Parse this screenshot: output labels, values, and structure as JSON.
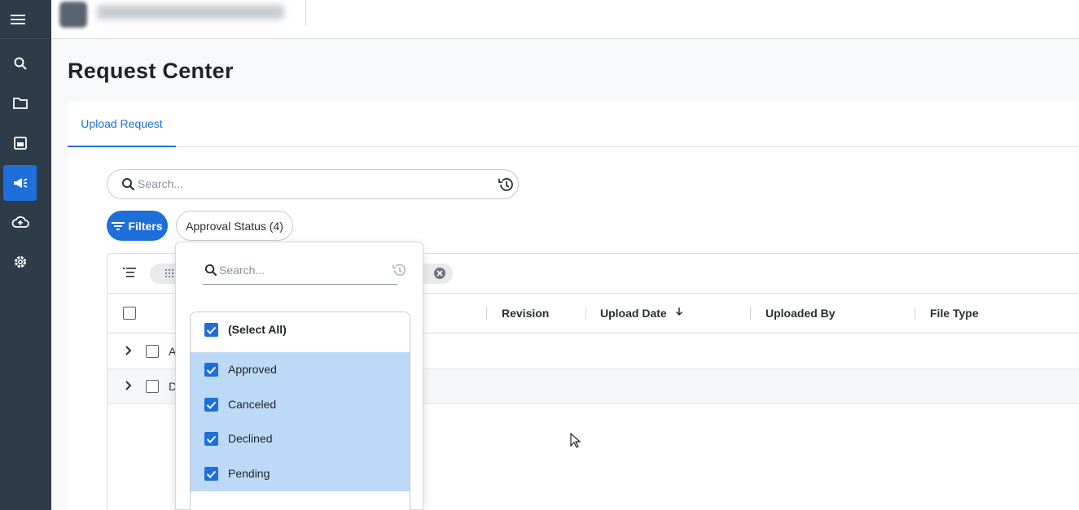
{
  "sidebar": {
    "items": [
      {
        "icon": "search-icon"
      },
      {
        "icon": "folder-icon"
      },
      {
        "icon": "clipboard-icon"
      },
      {
        "icon": "megaphone-icon",
        "active": true
      },
      {
        "icon": "cloud-upload-icon"
      },
      {
        "icon": "gear-icon"
      }
    ]
  },
  "page": {
    "title": "Request Center"
  },
  "tabs": [
    {
      "label": "Upload Request",
      "active": true
    }
  ],
  "search": {
    "placeholder": "Search..."
  },
  "filters": {
    "button_label": "Filters",
    "chip_label": "Approval Status (4)"
  },
  "table": {
    "columns": [
      "Revision",
      "Upload Date",
      "Uploaded By",
      "File Type"
    ],
    "sort_column": "Upload Date",
    "sort_direction": "descending",
    "rows": [
      {
        "text": "A"
      },
      {
        "text": "D"
      }
    ]
  },
  "dropdown": {
    "search_placeholder": "Search...",
    "select_all_label": "(Select All)",
    "options": [
      {
        "label": "Approved",
        "checked": true
      },
      {
        "label": "Canceled",
        "checked": true
      },
      {
        "label": "Declined",
        "checked": true
      },
      {
        "label": "Pending",
        "checked": true
      }
    ]
  },
  "colors": {
    "accent": "#1e6fd9",
    "sidebar": "#2e3b49",
    "selected_row": "#bcd9f7"
  }
}
